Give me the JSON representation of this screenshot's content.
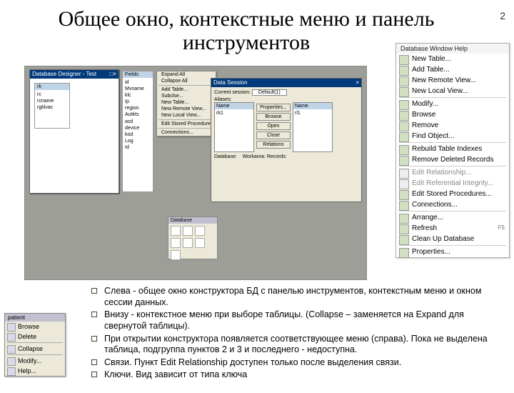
{
  "page_number": "2",
  "title": "Общее окно, контекстные меню и панель инструментов",
  "screenshot": {
    "designer_window_title": "Database Designer - Test",
    "left_panel": {
      "header": "rk",
      "items": [
        "rc",
        "rcname",
        "rgklvac"
      ]
    },
    "relation_panel": {
      "header": "Fields:",
      "items": [
        "id",
        "Mvname",
        "klc",
        "Ip",
        "region",
        "Autkts",
        "asd",
        "device",
        "kod",
        "Log",
        "Id"
      ]
    },
    "ctx_table": {
      "items_1": [
        "Expand All",
        "Collapse All"
      ],
      "items_2": [
        "Add Table...",
        "Subclse...",
        "New Table...",
        "New Remote View...",
        "New Local View..."
      ],
      "items_3": [
        "Edit Stored Procedures..."
      ],
      "items_4": [
        "Connections..."
      ]
    },
    "session_win": {
      "title": "Data Session",
      "cur_label": "Current session:",
      "cur_value": "Default(1)",
      "aliases_label": "Aliases:",
      "left_header": "Name",
      "left_items": [
        "rk1"
      ],
      "right_header": "Name",
      "right_items": [
        "rl1"
      ],
      "bottom_label": "Database:",
      "bottom_r": "Workarea:",
      "bottom_r2": "Records:",
      "buttons": [
        "Properties...",
        "Browse",
        "Open",
        "Close",
        "Relations"
      ]
    },
    "toolbar_title": "Database"
  },
  "right_menu": {
    "header": "Database   Window   Help",
    "g1": [
      "New Table...",
      "Add Table...",
      "New Remote View...",
      "New Local View..."
    ],
    "g2": [
      "Modify...",
      "Browse",
      "Remove",
      "Find Object..."
    ],
    "g3": [
      "Rebuild Table Indexes",
      "Remove Deleted Records"
    ],
    "g4_dim": [
      "Edit Relationship...",
      "Edit Referential Integrity..."
    ],
    "g4": [
      "Edit Stored Procedures...",
      "Connections..."
    ],
    "g5": [
      "Arrange...",
      "Refresh",
      "Clean Up Database"
    ],
    "refresh_key": "F5",
    "g6": [
      "Properties..."
    ]
  },
  "mini_menu": {
    "title": "patient",
    "items_1": [
      "Browse",
      "Delete"
    ],
    "items_2": [
      "Collapse"
    ],
    "items_3": [
      "Modify...",
      "Help..."
    ]
  },
  "bullets": [
    "Слева  - общее окно конструктора БД с панелью инструментов, контекстным меню и окном сессии данных.",
    "Внизу  - контекстное меню при выборе таблицы. (Collapse – заменяется на Expand для свернутой таблицы).",
    "При открытии конструктора появляется соответствующее меню (справа). Пока не выделена таблица, подгруппа пунктов 2 и 3 и последнего  - недоступна.",
    "Связи. Пункт Edit Relationship доступен только после выделения связи.",
    "Ключи. Вид зависит от типа ключа"
  ]
}
